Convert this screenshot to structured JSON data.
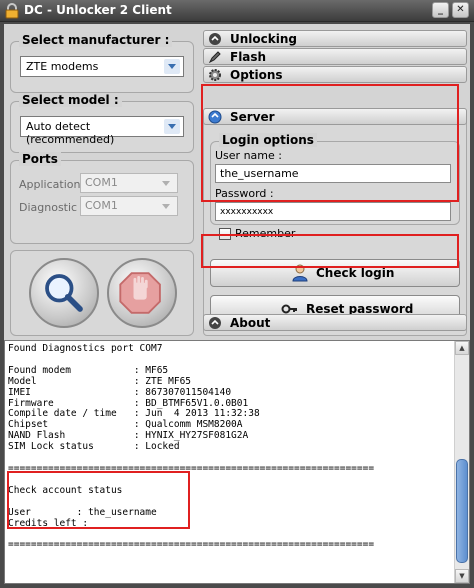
{
  "window": {
    "title": "DC - Unlocker 2 Client",
    "minimize_glyph": "_",
    "close_glyph": "✕"
  },
  "manufacturer": {
    "label": "Select manufacturer :",
    "value": "ZTE modems"
  },
  "model": {
    "label": "Select model :",
    "value": "Auto detect (recommended)"
  },
  "ports": {
    "label": "Ports",
    "application_label": "Application",
    "application_value": "COM1",
    "diagnostic_label": "Diagnostic",
    "diagnostic_value": "COM1"
  },
  "tabs": {
    "unlocking": "Unlocking",
    "flash": "Flash",
    "options": "Options",
    "server": "Server",
    "about": "About"
  },
  "login": {
    "group_label": "Login options",
    "username_label": "User name :",
    "username_value": "the_username",
    "password_label": "Password :",
    "password_value": "xxxxxxxxxx",
    "remember_label": "Remember",
    "remember_checked": false
  },
  "buttons": {
    "check_login": "Check login",
    "reset_password": "Reset password"
  },
  "icons": {
    "app": "padlock-icon",
    "search": "magnifier-icon",
    "stop": "stop-hand-icon",
    "unlocking": "padlock-icon",
    "flash": "pen-icon",
    "options": "gear-icon",
    "server": "globe-icon",
    "about": "info-icon",
    "check_login": "user-icon",
    "reset_password": "key-icon"
  },
  "colors": {
    "highlight": "#e02020",
    "scroll_thumb": "#5e8fcf"
  },
  "log": {
    "lines": [
      "Found Diagnostics port COM7",
      "",
      "Found modem           : MF65",
      "Model                 : ZTE MF65",
      "IMEI                  : 867307011504140",
      "Firmware              : BD_BTMF65V1.0.0B01",
      "Compile date / time   : Jun  4 2013 11:32:38",
      "Chipset               : Qualcomm MSM8200A",
      "NAND Flash            : HYNIX_HY27SF081G2A",
      "SIM Lock status       : Locked",
      "",
      "================================================================",
      "",
      "Check account status",
      "",
      "User        : the_username",
      "Credits left :",
      "",
      "================================================================"
    ]
  }
}
